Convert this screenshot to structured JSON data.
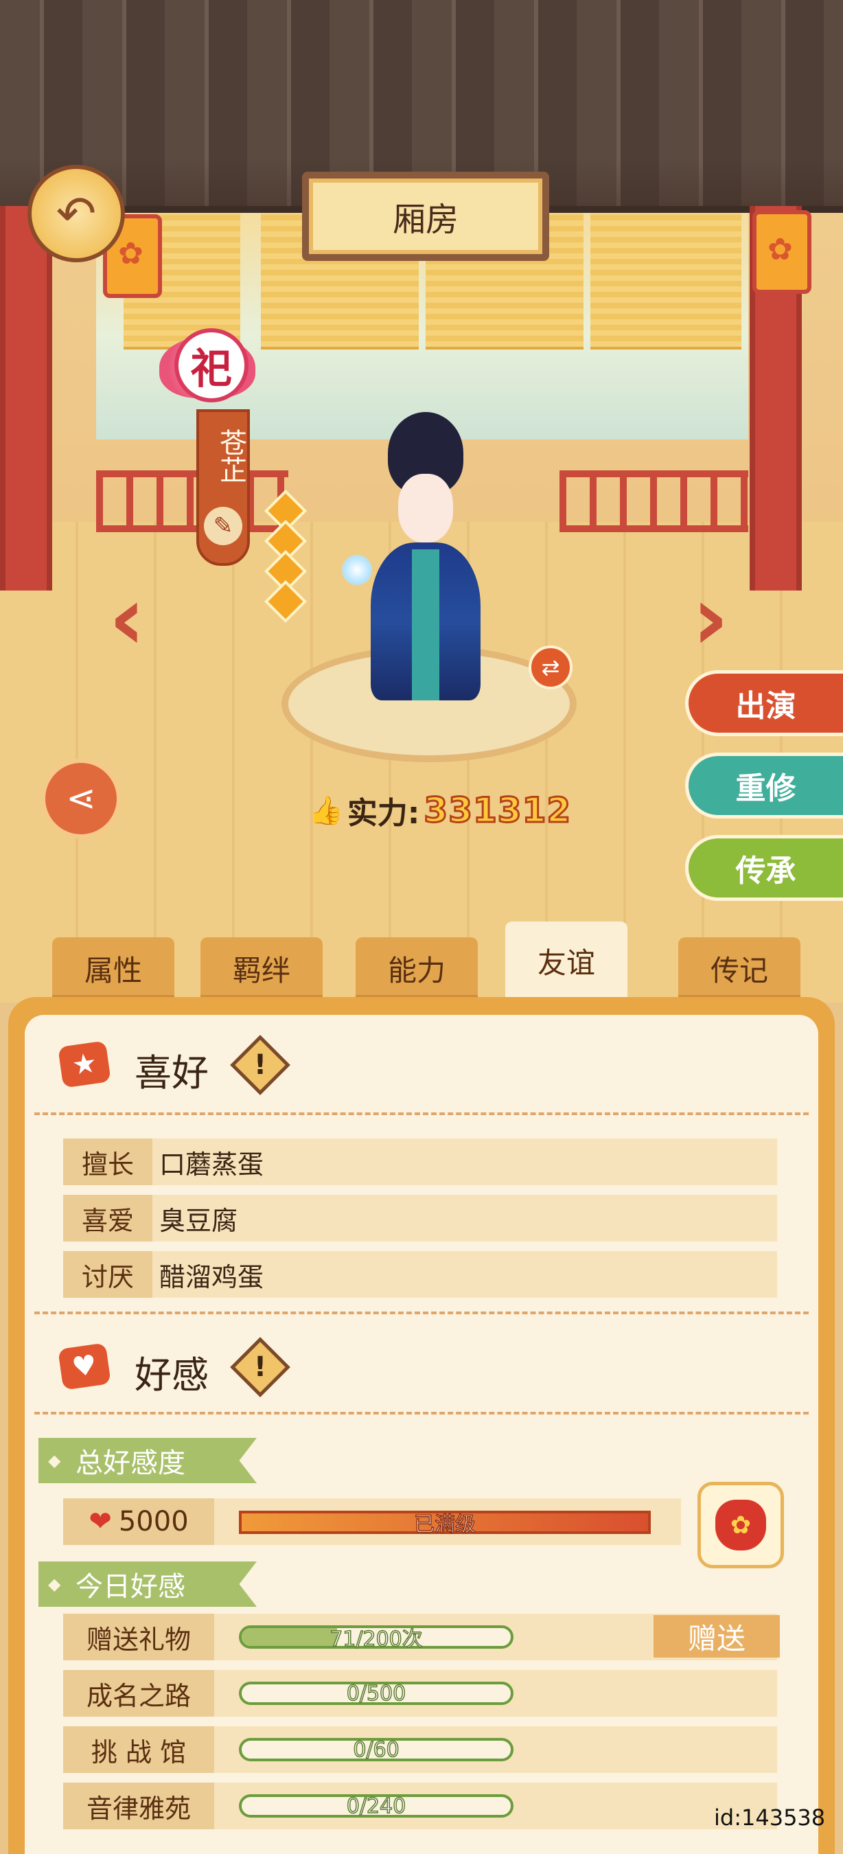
{
  "header": {
    "title": "厢房",
    "back_icon": "back-arrow-icon"
  },
  "character": {
    "role_badge": "祀",
    "name": "苍芷",
    "stars": 4,
    "power_label": "实力:",
    "power_value": "331312"
  },
  "actions": {
    "perform": "出演",
    "retrain": "重修",
    "inherit": "传承"
  },
  "tabs": [
    {
      "label": "属性",
      "active": false
    },
    {
      "label": "羁绊",
      "active": false
    },
    {
      "label": "能力",
      "active": false
    },
    {
      "label": "友谊",
      "active": true
    },
    {
      "label": "传记",
      "active": false
    }
  ],
  "preferences": {
    "title": "喜好",
    "rows": [
      {
        "label": "擅长",
        "value": "口蘑蒸蛋"
      },
      {
        "label": "喜爱",
        "value": "臭豆腐"
      },
      {
        "label": "讨厌",
        "value": "醋溜鸡蛋"
      }
    ]
  },
  "affection": {
    "title": "好感",
    "total_label": "总好感度",
    "total_value": "5000",
    "total_status": "已满级",
    "total_progress": 1.0,
    "today_label": "今日好感",
    "gift_button": "赠送",
    "today_rows": [
      {
        "label": "赠送礼物",
        "text": "71/200次",
        "progress": 0.355
      },
      {
        "label": "成名之路",
        "text": "0/500",
        "progress": 0
      },
      {
        "label": "挑 战 馆",
        "text": "0/60",
        "progress": 0
      },
      {
        "label": "音律雅苑",
        "text": "0/240",
        "progress": 0
      }
    ]
  },
  "footer": {
    "id": "id:143538"
  },
  "colors": {
    "accent_red": "#e2562f",
    "accent_green": "#a9c06b",
    "panel_bg": "#fbf3df",
    "tab_bg": "#e2a54e"
  }
}
